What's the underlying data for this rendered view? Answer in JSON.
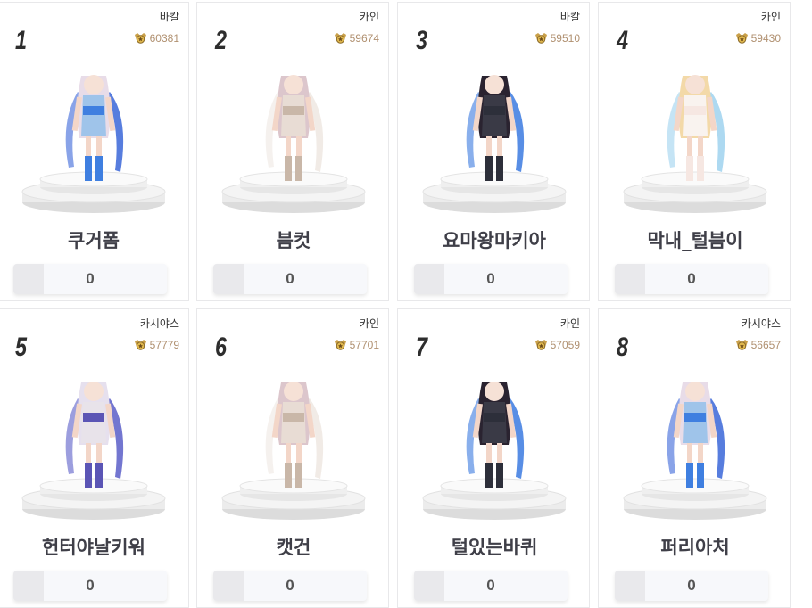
{
  "ranking": [
    {
      "rank": "1",
      "server": "바칼",
      "score": "60381",
      "name": "쿠거폼",
      "votes": "0",
      "hair": "#e8dce8",
      "accent": "#3f7fe0",
      "outfit": "#9fc4ea",
      "weapon": "#3a66d8"
    },
    {
      "rank": "2",
      "server": "카인",
      "score": "59674",
      "name": "븜컷",
      "votes": "0",
      "hair": "#dcc6cc",
      "accent": "#c9b7a8",
      "outfit": "#e8dcd4",
      "weapon": "#efe7e2"
    },
    {
      "rank": "3",
      "server": "바칼",
      "score": "59510",
      "name": "요마왕마키아",
      "votes": "0",
      "hair": "#2a2330",
      "accent": "#2d2f3a",
      "outfit": "#3a3a46",
      "weapon": "#3b7ae0"
    },
    {
      "rank": "4",
      "server": "카인",
      "score": "59430",
      "name": "막내_털븜이",
      "votes": "0",
      "hair": "#f3d9a8",
      "accent": "#f6e7e2",
      "outfit": "#f9f3ef",
      "weapon": "#9fd2ee"
    },
    {
      "rank": "5",
      "server": "카시야스",
      "score": "57779",
      "name": "헌터야날키워",
      "votes": "0",
      "hair": "#e6e0ee",
      "accent": "#5b55b5",
      "outfit": "#e8e3ea",
      "weapon": "#5a5ec8"
    },
    {
      "rank": "6",
      "server": "카인",
      "score": "57701",
      "name": "캣건",
      "votes": "0",
      "hair": "#dcc6cc",
      "accent": "#c9b7a8",
      "outfit": "#e8dcd4",
      "weapon": "#efe7e2"
    },
    {
      "rank": "7",
      "server": "카인",
      "score": "57059",
      "name": "털있는바퀴",
      "votes": "0",
      "hair": "#2a2330",
      "accent": "#2d2f3a",
      "outfit": "#3a3a46",
      "weapon": "#3b7ae0"
    },
    {
      "rank": "8",
      "server": "카시야스",
      "score": "56657",
      "name": "퍼리아처",
      "votes": "0",
      "hair": "#e8dce8",
      "accent": "#3f7fe0",
      "outfit": "#9fc4ea",
      "weapon": "#3a66d8"
    }
  ],
  "icons": {
    "medal": "gold-medal-icon",
    "pedestal": "pedestal",
    "character": "character-avatar"
  },
  "colors": {
    "score_text": "#b09070",
    "name_text": "#3f3f48",
    "card_border": "#e8e8ea"
  }
}
